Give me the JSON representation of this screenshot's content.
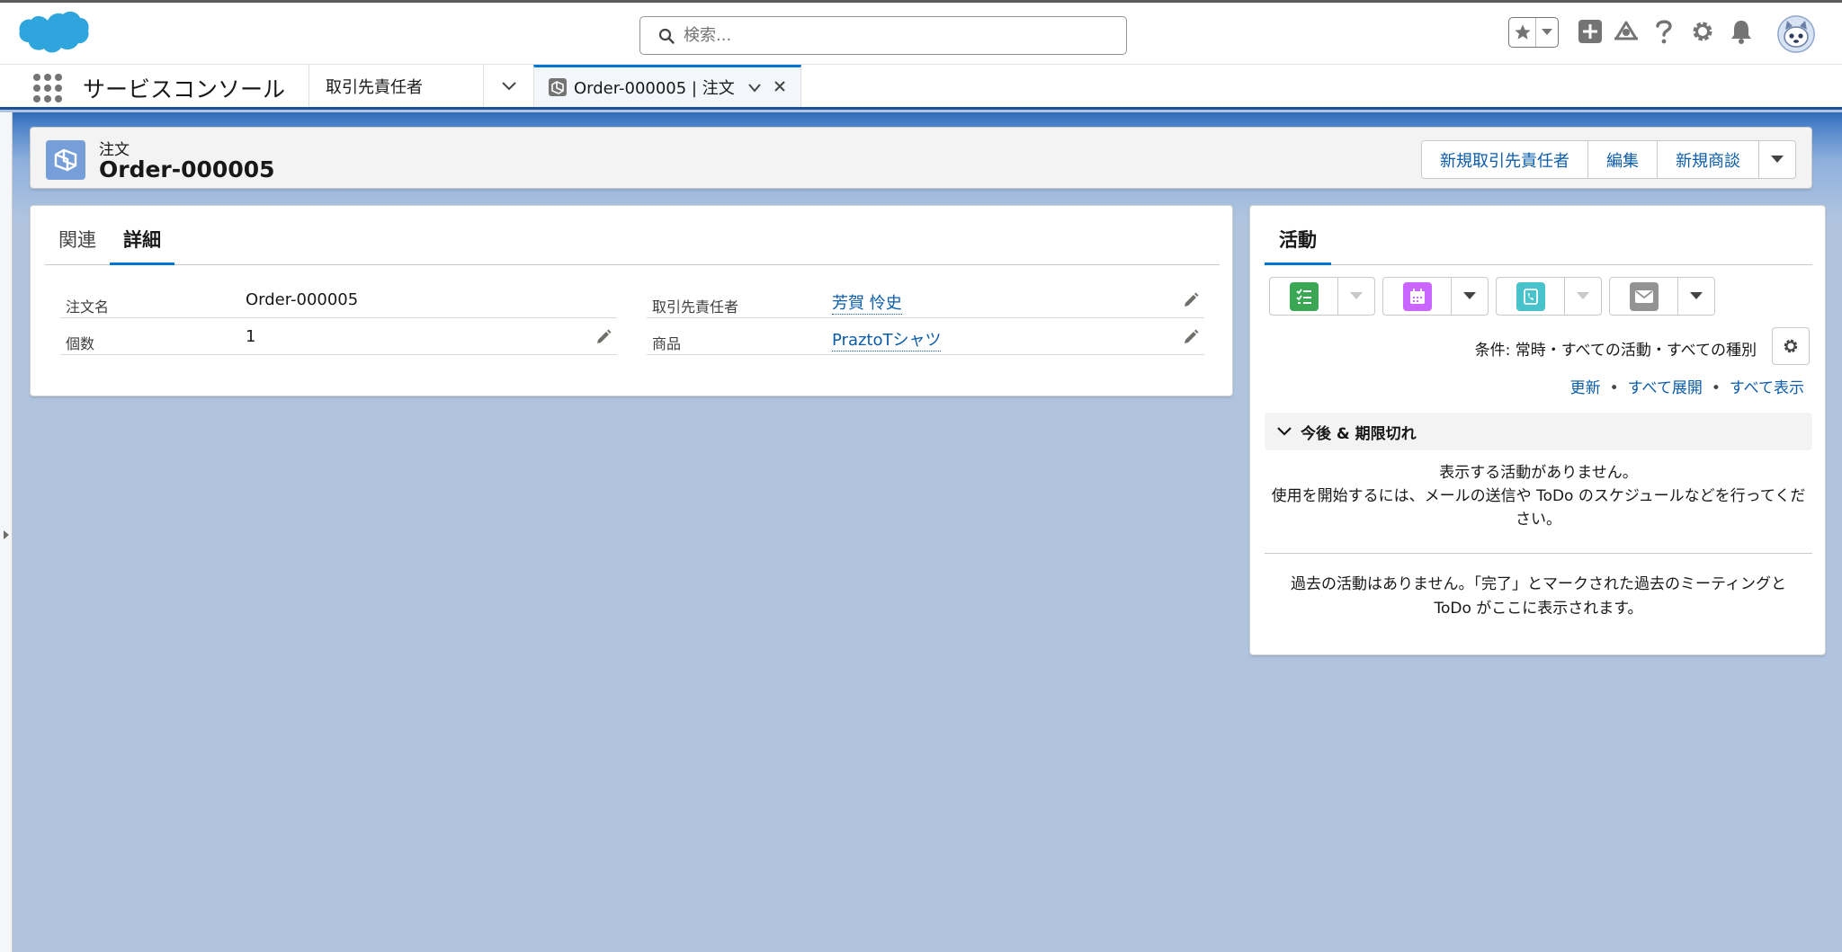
{
  "header": {
    "search_placeholder": "検索...",
    "icons": [
      "favorites-star-icon",
      "favorites-menu-icon",
      "global-actions-icon",
      "trailhead-icon",
      "help-icon",
      "setup-gear-icon",
      "notifications-bell-icon",
      "user-avatar"
    ]
  },
  "nav": {
    "app_name": "サービスコンソール",
    "tabs": [
      {
        "label": "取引先責任者"
      },
      {
        "label": "Order-000005 | 注文",
        "active": true
      }
    ]
  },
  "record": {
    "type": "注文",
    "title": "Order-000005",
    "actions": [
      "新規取引先責任者",
      "編集",
      "新規商談"
    ]
  },
  "details": {
    "tabs": [
      "関連",
      "詳細"
    ],
    "active_tab": "詳細",
    "fields": {
      "order_name": {
        "label": "注文名",
        "value": "Order-000005"
      },
      "quantity": {
        "label": "個数",
        "value": "1"
      },
      "contact": {
        "label": "取引先責任者",
        "value": "芳賀 怜史"
      },
      "product": {
        "label": "商品",
        "value": "PraztoTシャツ"
      }
    }
  },
  "activity": {
    "tab": "活動",
    "publishers": [
      "new-task",
      "new-event",
      "log-call",
      "email"
    ],
    "filter_text": "条件: 常時・すべての活動・すべての種別",
    "links": {
      "refresh": "更新",
      "expand_all": "すべて展開",
      "show_all": "すべて表示"
    },
    "upcoming_section": "今後 & 期限切れ",
    "empty_title": "表示する活動がありません。",
    "empty_desc": "使用を開始するには、メールの送信や ToDo のスケジュールなどを行ってください。",
    "past_empty": "過去の活動はありません。「完了」とマークされた過去のミーティングと ToDo がここに表示されます。"
  },
  "colors": {
    "brand_blue": "#0176d3",
    "link_blue": "#0b5cab",
    "nav_underline": "#1b5297",
    "task_green": "#3ba755",
    "event_purple": "#cb65ff",
    "call_teal": "#48c3cc",
    "email_gray": "#939393",
    "order_icon": "#769ed9"
  }
}
